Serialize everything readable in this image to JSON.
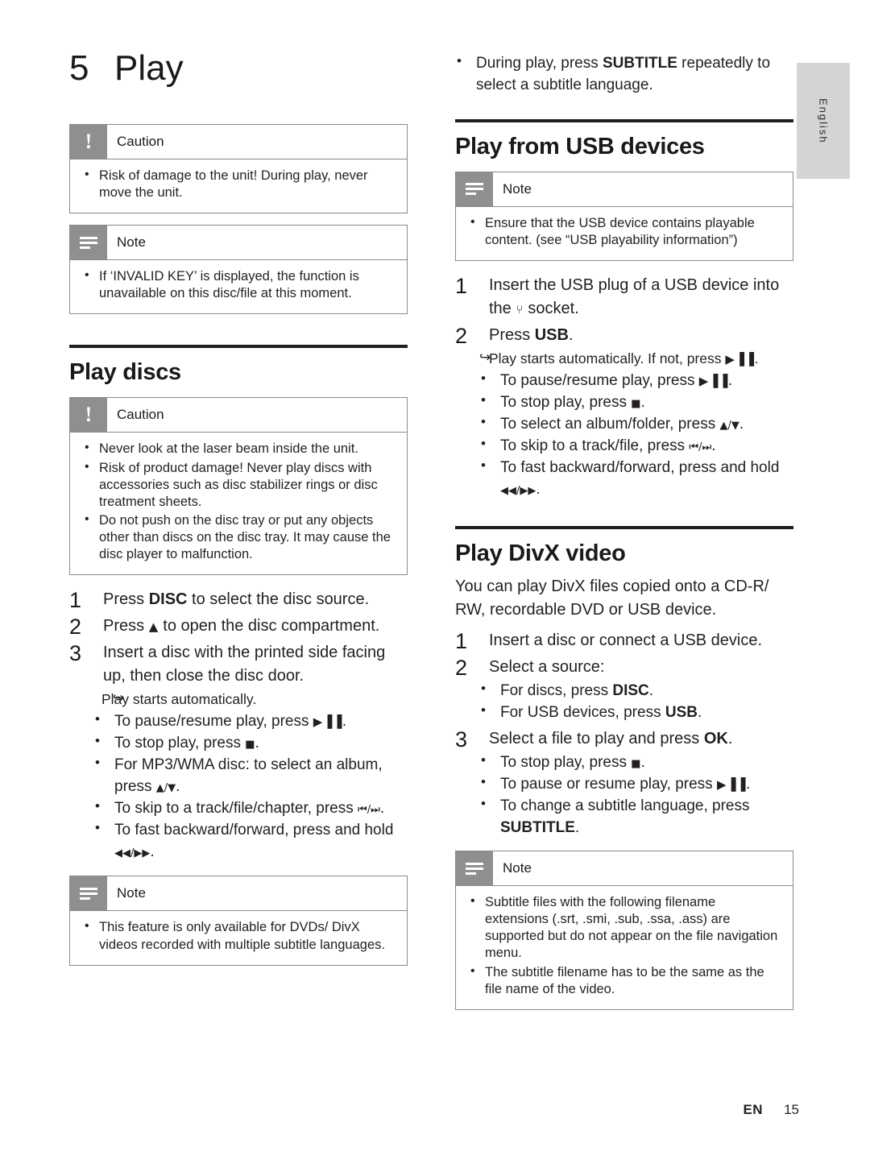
{
  "side_tab": {
    "label": "English"
  },
  "chapter": {
    "number": "5",
    "title": "Play"
  },
  "left": {
    "caution1": {
      "icon": "exclamation-icon",
      "label": "Caution",
      "items": [
        "Risk of damage to the unit! During play, never move the unit."
      ]
    },
    "note1": {
      "icon": "note-icon",
      "label": "Note",
      "items": [
        "If ‘INVALID KEY’ is displayed, the function is unavailable on this disc/file at this moment."
      ]
    },
    "section_play_discs": "Play discs",
    "caution2": {
      "icon": "exclamation-icon",
      "label": "Caution",
      "items": [
        "Never look at the laser beam inside the unit.",
        "Risk of product damage! Never play discs with accessories such as disc stabilizer rings or disc treatment sheets.",
        "Do not push on the disc tray or put any objects other than discs on the disc tray. It may cause the disc player to malfunction."
      ]
    },
    "steps": [
      {
        "n": "1",
        "text_before": "Press ",
        "kw": "DISC",
        "text_after": " to select the disc source."
      },
      {
        "n": "2",
        "text_before": "Press ",
        "glyph": "▲",
        "text_after": " to open the disc compartment."
      },
      {
        "n": "3",
        "text_before": "Insert a disc with the printed side facing up, then close the disc door.",
        "kw": "",
        "text_after": ""
      }
    ],
    "arrow_line": "Play starts automatically.",
    "bullets": [
      {
        "text_before": "To pause/resume play, press ",
        "glyph": "▶▐▐",
        "text_after": "."
      },
      {
        "text_before": "To stop play, press ",
        "glyph": "■",
        "text_after": "."
      },
      {
        "text_before": "For MP3/WMA disc: to select an album, press ",
        "glyph": "▲/▼",
        "text_after": "."
      },
      {
        "text_before": "To skip to a track/file/chapter, press ",
        "glyph": "⏮/⏭",
        "text_after": "."
      },
      {
        "text_before": "To fast backward/forward, press and hold ",
        "glyph": "◀◀/▶▶",
        "text_after": "."
      }
    ],
    "note2": {
      "icon": "note-icon",
      "label": "Note",
      "items": [
        "This feature is only available for DVDs/ DivX videos recorded with multiple subtitle languages."
      ]
    }
  },
  "right": {
    "top_bullet": {
      "text_before": "During play, press ",
      "kw": "SUBTITLE",
      "text_after": " repeatedly to select a subtitle language."
    },
    "section_usb": "Play from USB devices",
    "note_usb": {
      "icon": "note-icon",
      "label": "Note",
      "items": [
        "Ensure that the USB device contains playable content. (see “USB playability information”)"
      ]
    },
    "usb_steps": [
      {
        "n": "1",
        "text_before": "Insert the USB plug of a USB device into the ",
        "glyph": "⑂",
        "text_after": " socket."
      },
      {
        "n": "2",
        "text_before": "Press ",
        "kw": "USB",
        "text_after": "."
      }
    ],
    "usb_arrow": {
      "text_before": "Play starts automatically. If not, press ",
      "glyph": "▶▐▐",
      "text_after": "."
    },
    "usb_bullets": [
      {
        "text_before": "To pause/resume play, press ",
        "glyph": "▶▐▐",
        "text_after": "."
      },
      {
        "text_before": "To stop play, press ",
        "glyph": "■",
        "text_after": "."
      },
      {
        "text_before": "To select an album/folder, press ",
        "glyph": "▲/▼",
        "text_after": "."
      },
      {
        "text_before": "To skip to a track/file, press ",
        "glyph": "⏮/⏭",
        "text_after": "."
      },
      {
        "text_before": "To fast backward/forward, press and hold ",
        "glyph": "◀◀/▶▶",
        "text_after": "."
      }
    ],
    "section_divx": "Play DivX video",
    "divx_intro": "You can play DivX files copied onto a CD-R/ RW, recordable DVD or USB device.",
    "divx_steps": [
      {
        "n": "1",
        "text": "Insert a disc or connect a USB device."
      },
      {
        "n": "2",
        "text": "Select a source:"
      },
      {
        "n": "3",
        "text_before": "Select a file to play and press ",
        "kw": "OK",
        "text_after": "."
      }
    ],
    "divx_source_bullets": [
      {
        "text_before": "For discs, press ",
        "kw": "DISC",
        "text_after": "."
      },
      {
        "text_before": "For USB devices, press ",
        "kw": "USB",
        "text_after": "."
      }
    ],
    "divx_play_bullets": [
      {
        "text_before": "To stop play, press ",
        "glyph": "■",
        "text_after": "."
      },
      {
        "text_before": "To pause or resume play, press ",
        "glyph": "▶▐▐",
        "text_after": "."
      },
      {
        "text_before": "To change a subtitle language, press ",
        "kw": "SUBTITLE",
        "text_after": "."
      }
    ],
    "note_divx": {
      "icon": "note-icon",
      "label": "Note",
      "items": [
        "Subtitle files with the following filename extensions (.srt, .smi, .sub, .ssa, .ass) are supported but do not appear on the file navigation menu.",
        "The subtitle filename has to be the same as the file name of the video."
      ]
    }
  },
  "footer": {
    "lang": "EN",
    "page": "15"
  }
}
